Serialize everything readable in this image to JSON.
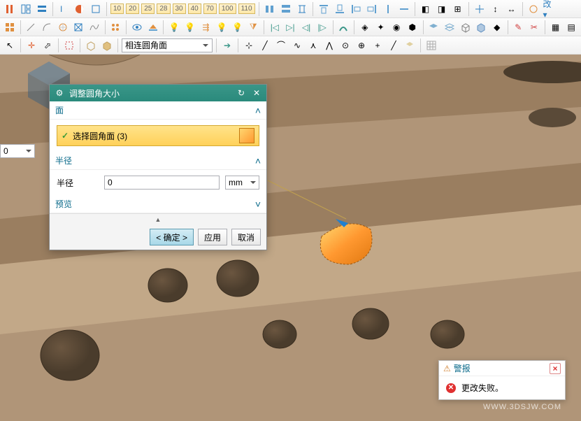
{
  "toolbar1": {
    "nums": [
      "10",
      "20",
      "25",
      "28",
      "30",
      "40",
      "70",
      "100",
      "110"
    ]
  },
  "toolbar3": {
    "filter_label": "相连圆角面"
  },
  "left_dd": {
    "value": "0"
  },
  "dialog": {
    "title": "调整圆角大小",
    "sections": {
      "face": {
        "header": "面",
        "select_label": "选择圆角面 (3)"
      },
      "radius": {
        "header": "半径",
        "label": "半径",
        "value": "0",
        "unit": "mm"
      },
      "preview": {
        "header": "预览"
      }
    },
    "buttons": {
      "ok": "< 确定 >",
      "apply": "应用",
      "cancel": "取消"
    }
  },
  "alert": {
    "title": "警报",
    "message": "更改失败。"
  },
  "watermark": {
    "url": "WWW.3DSJW.COM"
  }
}
